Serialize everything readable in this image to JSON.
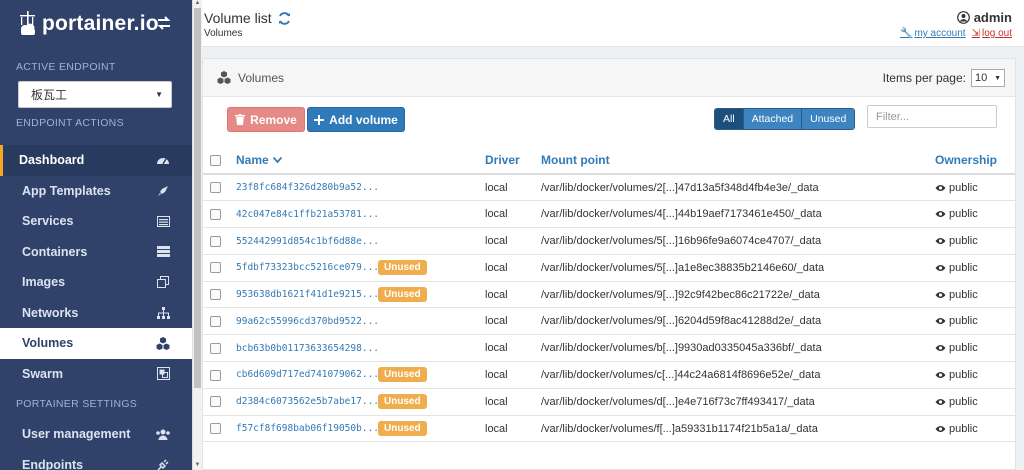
{
  "brand": {
    "name": "portainer.io"
  },
  "sidebar": {
    "active_endpoint_title": "ACTIVE ENDPOINT",
    "endpoint_value": "板瓦工",
    "endpoint_actions_title": "ENDPOINT ACTIONS",
    "items": [
      {
        "label": "Dashboard",
        "icon": "dashboard-icon"
      },
      {
        "label": "App Templates",
        "icon": "rocket-icon"
      },
      {
        "label": "Services",
        "icon": "list-alt-icon"
      },
      {
        "label": "Containers",
        "icon": "server-icon"
      },
      {
        "label": "Images",
        "icon": "clone-icon"
      },
      {
        "label": "Networks",
        "icon": "sitemap-icon"
      },
      {
        "label": "Volumes",
        "icon": "cubes-icon"
      },
      {
        "label": "Swarm",
        "icon": "object-group-icon"
      }
    ],
    "settings_title": "PORTAINER SETTINGS",
    "settings_items": [
      {
        "label": "User management",
        "icon": "users-icon"
      },
      {
        "label": "Endpoints",
        "icon": "plug-icon"
      }
    ]
  },
  "header": {
    "title": "Volume list",
    "breadcrumb": "Volumes",
    "username": "admin",
    "my_account": "my account",
    "log_out": "log out"
  },
  "panel": {
    "title": "Volumes",
    "items_per_page_label": "Items per page:",
    "items_per_page_value": "10",
    "remove_label": "Remove",
    "add_label": "Add volume",
    "filters": [
      "All",
      "Attached",
      "Unused"
    ],
    "filter_placeholder": "Filter...",
    "columns": {
      "name": "Name",
      "driver": "Driver",
      "mount": "Mount point",
      "ownership": "Ownership"
    },
    "unused_label": "Unused",
    "rows": [
      {
        "name": "23f8fc684f326d280b9a52...",
        "unused": false,
        "driver": "local",
        "mount": "/var/lib/docker/volumes/2[...]47d13a5f348d4fb4e3e/_data",
        "ownership": "public"
      },
      {
        "name": "42c047e84c1ffb21a53781...",
        "unused": false,
        "driver": "local",
        "mount": "/var/lib/docker/volumes/4[...]44b19aef7173461e450/_data",
        "ownership": "public"
      },
      {
        "name": "552442991d854c1bf6d88e...",
        "unused": false,
        "driver": "local",
        "mount": "/var/lib/docker/volumes/5[...]16b96fe9a6074ce4707/_data",
        "ownership": "public"
      },
      {
        "name": "5fdbf73323bcc5216ce079...",
        "unused": true,
        "driver": "local",
        "mount": "/var/lib/docker/volumes/5[...]a1e8ec38835b2146e60/_data",
        "ownership": "public"
      },
      {
        "name": "953638db1621f41d1e9215...",
        "unused": true,
        "driver": "local",
        "mount": "/var/lib/docker/volumes/9[...]92c9f42bec86c21722e/_data",
        "ownership": "public"
      },
      {
        "name": "99a62c55996cd370bd9522...",
        "unused": false,
        "driver": "local",
        "mount": "/var/lib/docker/volumes/9[...]6204d59f8ac41288d2e/_data",
        "ownership": "public"
      },
      {
        "name": "bcb63b0b01173633654298...",
        "unused": false,
        "driver": "local",
        "mount": "/var/lib/docker/volumes/b[...]9930ad0335045a336bf/_data",
        "ownership": "public"
      },
      {
        "name": "cb6d609d717ed741079062...",
        "unused": true,
        "driver": "local",
        "mount": "/var/lib/docker/volumes/c[...]44c24a6814f8696e52e/_data",
        "ownership": "public"
      },
      {
        "name": "d2384c6073562e5b7abe17...",
        "unused": true,
        "driver": "local",
        "mount": "/var/lib/docker/volumes/d[...]e4e716f73c7ff493417/_data",
        "ownership": "public"
      },
      {
        "name": "f57cf8f698bab06f19050b...",
        "unused": true,
        "driver": "local",
        "mount": "/var/lib/docker/volumes/f[...]a59331b1174f21b5a1a/_data",
        "ownership": "public"
      }
    ]
  },
  "colors": {
    "sidebar_bg": "#30426a",
    "accent_blue": "#337ab7",
    "danger": "#e58a87",
    "warning": "#f0ad4e"
  }
}
